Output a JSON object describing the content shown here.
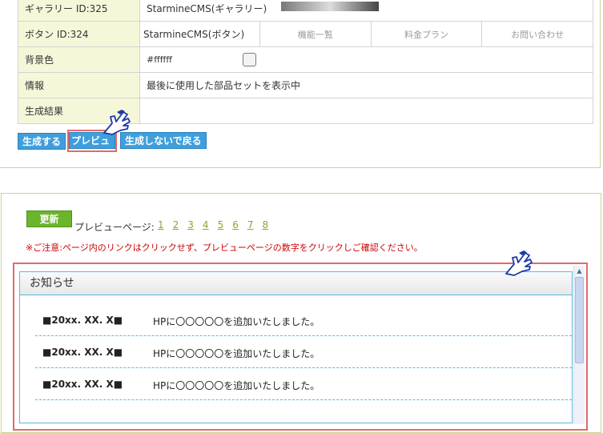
{
  "config_table": {
    "rows": [
      {
        "label": "ギャラリー ID:325",
        "value": "StarmineCMS(ギャラリー)"
      },
      {
        "label": "ボタン ID:324",
        "value": "StarmineCMS(ボタン)",
        "nav": [
          "機能一覧",
          "料金プラン",
          "お問い合わせ"
        ]
      },
      {
        "label": "背景色",
        "value": "#ffffff"
      },
      {
        "label": "情報",
        "value": "最後に使用した部品セットを表示中"
      },
      {
        "label": "生成結果",
        "value": ""
      }
    ]
  },
  "actions": {
    "generate": "生成する",
    "preview": "プレビュー",
    "back": "生成しないで戻る"
  },
  "preview_panel": {
    "update": "更新",
    "page_label": "プレビューページ:",
    "pages": [
      "1",
      "2",
      "3",
      "4",
      "5",
      "6",
      "7",
      "8"
    ],
    "notice": "※ご注意:ページ内のリンクはクリックせず、プレビューページの数字をクリックしご確認ください。",
    "news_title": "お知らせ",
    "news": [
      {
        "date": "■20xx. XX. X■",
        "text": "HPに〇〇〇〇〇を追加いたしました。"
      },
      {
        "date": "■20xx. XX. X■",
        "text": "HPに〇〇〇〇〇を追加いたしました。"
      },
      {
        "date": "■20xx. XX. X■",
        "text": "HPに〇〇〇〇〇を追加いたしました。"
      }
    ]
  },
  "colors": {
    "accent_blue": "#3f9fdc",
    "highlight_red": "#e36a6a",
    "update_green": "#6bb52c",
    "frame_blue": "#5bb8e0"
  }
}
